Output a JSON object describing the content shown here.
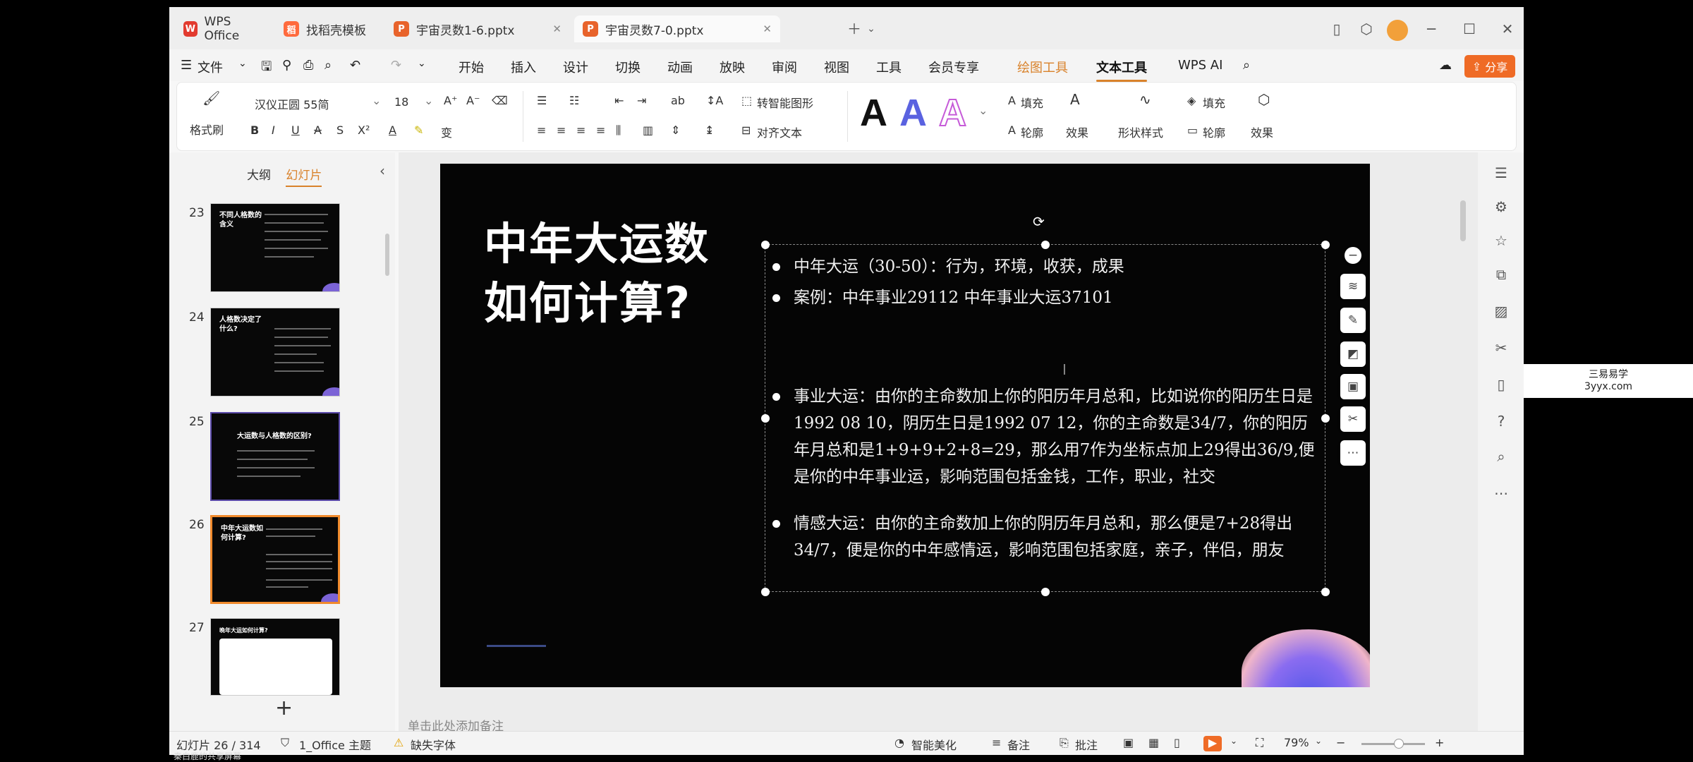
{
  "tabs": [
    {
      "label": "WPS Office",
      "icon": "wps-logo"
    },
    {
      "label": "找稻壳模板",
      "icon": "docer-logo"
    },
    {
      "label": "宇宙灵数1-6.pptx",
      "icon": "ppt-logo"
    },
    {
      "label": "宇宙灵数7-0.pptx",
      "icon": "ppt-logo"
    }
  ],
  "menu": {
    "file": "文件",
    "items": [
      "开始",
      "插入",
      "设计",
      "切换",
      "动画",
      "放映",
      "审阅",
      "视图",
      "工具",
      "会员专享"
    ],
    "drawing_tools": "绘图工具",
    "text_tools": "文本工具",
    "wps_ai": "WPS AI",
    "share": "分享"
  },
  "ribbon": {
    "format_painter": "格式刷",
    "font_name": "汉仪正圆 55简",
    "font_size": "18",
    "smart_shape": "转智能图形",
    "align_text": "对齐文本",
    "fill": "填充",
    "outline": "轮廓",
    "effect": "效果",
    "shape_style": "形状样式",
    "shape_fill": "填充",
    "shape_outline": "轮廓",
    "shape_effect": "效果",
    "bigA": "A"
  },
  "leftpanel": {
    "outline_tab": "大纲",
    "slides_tab": "幻灯片",
    "slides": [
      {
        "num": "23",
        "title": "不同人格数的含义"
      },
      {
        "num": "24",
        "title": "人格数决定了什么?"
      },
      {
        "num": "25",
        "title": "大运数与人格数的区别?"
      },
      {
        "num": "26",
        "title": "中年大运数如何计算?"
      },
      {
        "num": "27",
        "title": "晚年大运如何计算?"
      }
    ]
  },
  "slide": {
    "title_line1": "中年大运数",
    "title_line2": "如何计算?",
    "bullets": [
      "中年大运（30-50）：行为，环境，收获，成果",
      "案例：中年事业29112   中年事业大运37101",
      "事业大运：由你的主命数加上你的阳历年月总和，比如说你的阳历生日是1992 08 10，阴历生日是1992 07 12，你的主命数是34/7，你的阳历年月总和是1+9+9+2+8=29，那么用7作为坐标点加上29得出36/9,便是你的中年事业运，影响范围包括金钱，工作，职业，社交",
      "情感大运：由你的主命数加上你的阴历年月总和，那么便是7+28得出34/7，便是你的中年感情运，影响范围包括家庭，亲子，伴侣，朋友"
    ]
  },
  "notes_placeholder": "单击此处添加备注",
  "status": {
    "slide_count": "幻灯片 26 / 314",
    "theme": "1_Office 主题",
    "missing_font": "缺失字体",
    "smart_beautify": "智能美化",
    "notes": "备注",
    "comments": "批注",
    "zoom": "79%"
  },
  "watermark": {
    "line1": "三易易学",
    "line2": "3yyx.com"
  },
  "screen_share_label": "秦白鹿的共享屏幕",
  "colors": {
    "accent": "#d9822b",
    "share": "#ef6b26",
    "thumb_selected": "#f08a2c"
  }
}
